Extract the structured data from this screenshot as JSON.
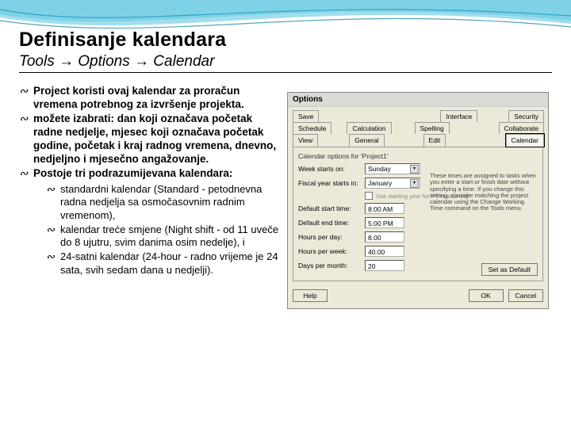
{
  "header": {
    "title": "Definisanje kalendara",
    "path": "Tools → Options → Calendar"
  },
  "bulletChar": "∾",
  "bullets": {
    "b1": "Project koristi ovaj kalendar za proračun vremena potrebnog za izvršenje projekta.",
    "b2": "možete izabrati: dan koji označava početak radne nedjelje, mjesec koji označava početak godine, početak i kraj radnog vremena, dnevno, nedjeljno i mjesečno angažovanje.",
    "b3": "Postoje tri podrazumijevana kalendara:",
    "s1": "standardni kalendar (Standard - petodnevna radna nedjelja sa osmočasovnim radnim vremenom),",
    "s2": "kalendar treće smjene (Night shift - od 11 uveče do 8 ujutru, svim danima osim nedelje), i",
    "s3": "24-satni kalendar (24-hour - radno vrijeme je 24 sata, svih sedam dana u nedjelji)."
  },
  "dialog": {
    "title": "Options",
    "tabs": {
      "row1": [
        "Save",
        "Interface",
        "Security"
      ],
      "row2": [
        "Schedule",
        "Calculation",
        "Spelling",
        "Collaborate"
      ],
      "row3": [
        "View",
        "General",
        "Edit",
        "Calendar"
      ]
    },
    "sectionLabel": "Calendar options for 'Project1'",
    "fields": {
      "weekStartsLabel": "Week starts on:",
      "weekStartsValue": "Sunday",
      "fiscalLabel": "Fiscal year starts in:",
      "fiscalValue": "January",
      "fiscalCheckbox": "Use starting year for FY numbering",
      "defStartLabel": "Default start time:",
      "defStartValue": "8:00 AM",
      "defEndLabel": "Default end time:",
      "defEndValue": "5:00 PM",
      "hpdLabel": "Hours per day:",
      "hpdValue": "8.00",
      "hpwLabel": "Hours per week:",
      "hpwValue": "40.00",
      "dpmLabel": "Days per month:",
      "dpmValue": "20"
    },
    "hint": "These times are assigned to tasks when you enter a start or finish date without specifying a time. If you change this setting, consider matching the project calendar using the Change Working Time command on the Tools menu.",
    "buttons": {
      "setDefault": "Set as Default",
      "help": "Help",
      "ok": "OK",
      "cancel": "Cancel"
    }
  }
}
